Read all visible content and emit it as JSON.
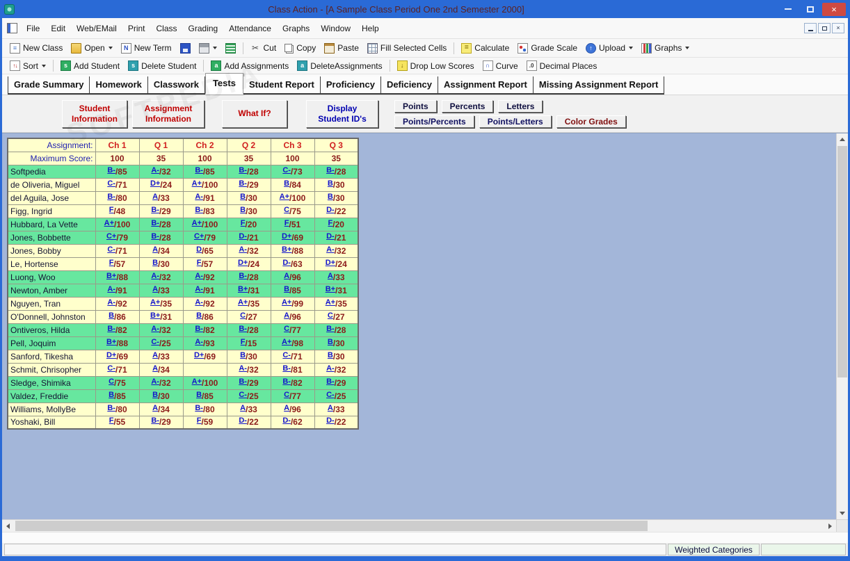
{
  "window": {
    "title": "Class Action - [A Sample Class Period One 2nd Semester 2000]"
  },
  "watermark": "SOFTPEDIA",
  "menu": {
    "items": [
      "File",
      "Edit",
      "Web/EMail",
      "Print",
      "Class",
      "Grading",
      "Attendance",
      "Graphs",
      "Window",
      "Help"
    ]
  },
  "toolbars": {
    "top": [
      {
        "label": "New Class",
        "icon": "new-class"
      },
      {
        "label": "Open",
        "icon": "open-folder",
        "dropdown": true
      },
      {
        "label": "New Term",
        "icon": "new-term"
      },
      {
        "icon": "save"
      },
      {
        "icon": "print",
        "dropdown": true
      },
      {
        "icon": "grade-guide"
      },
      {
        "sep": true
      },
      {
        "label": "Cut",
        "icon": "cut"
      },
      {
        "label": "Copy",
        "icon": "copy"
      },
      {
        "label": "Paste",
        "icon": "paste"
      },
      {
        "label": "Fill Selected Cells",
        "icon": "fill-cells"
      },
      {
        "sep": true
      },
      {
        "label": "Calculate",
        "icon": "calculate"
      },
      {
        "label": "Grade Scale",
        "icon": "grade-scale"
      },
      {
        "label": "Upload",
        "icon": "upload",
        "dropdown": true
      },
      {
        "label": "Graphs",
        "icon": "graphs",
        "dropdown": true
      }
    ],
    "second": [
      {
        "label": "Sort",
        "icon": "sort",
        "dropdown": true
      },
      {
        "sep": true
      },
      {
        "label": "Add Student",
        "icon": "add-student"
      },
      {
        "label": "Delete Student",
        "icon": "delete-student"
      },
      {
        "sep": true
      },
      {
        "label": "Add Assignments",
        "icon": "add-assignments"
      },
      {
        "label": "DeleteAssignments",
        "icon": "delete-assignments"
      },
      {
        "sep": true
      },
      {
        "label": "Drop Low Scores",
        "icon": "drop-low-scores"
      },
      {
        "label": "Curve",
        "icon": "curve"
      },
      {
        "label": "Decimal Places",
        "icon": "decimal-places"
      }
    ]
  },
  "tabs": {
    "items": [
      "Grade Summary",
      "Homework",
      "Classwork",
      "Tests",
      "Student Report",
      "Proficiency",
      "Deficiency",
      "Assignment Report",
      "Missing Assignment Report"
    ],
    "active": "Tests"
  },
  "panel": {
    "big_buttons": [
      {
        "label": "Student Information",
        "color": "#c00000"
      },
      {
        "label": "Assignment Information",
        "color": "#c00000"
      },
      {
        "label": "What If?",
        "color": "#c00000"
      },
      {
        "label": "Display Student ID's",
        "color": "#0000b0"
      }
    ],
    "view_buttons": [
      [
        {
          "label": "Points",
          "color": "#101040"
        },
        {
          "label": "Percents",
          "color": "#101040"
        },
        {
          "label": "Letters",
          "color": "#101040"
        }
      ],
      [
        {
          "label": "Points/Percents",
          "color": "#101060"
        },
        {
          "label": "Points/Letters",
          "color": "#101060"
        },
        {
          "label": "Color Grades",
          "color": "#801010"
        }
      ]
    ]
  },
  "table": {
    "corner_label": "Assignment:",
    "max_label": "Maximum Score:",
    "columns": [
      "Ch 1",
      "Q 1",
      "Ch 2",
      "Q 2",
      "Ch 3",
      "Q 3"
    ],
    "max_scores": [
      "100",
      "35",
      "100",
      "35",
      "100",
      "35"
    ],
    "rows": [
      {
        "name": "Softpedia",
        "color": "green",
        "grades": [
          [
            "B-",
            "85"
          ],
          [
            "A-",
            "32"
          ],
          [
            "B-",
            "85"
          ],
          [
            "B-",
            "28"
          ],
          [
            "C-",
            "73"
          ],
          [
            "B-",
            "28"
          ]
        ]
      },
      {
        "name": "de Oliveria, Miguel",
        "color": "yellow",
        "grades": [
          [
            "C-",
            "71"
          ],
          [
            "D+",
            "24"
          ],
          [
            "A+",
            "100"
          ],
          [
            "B-",
            "29"
          ],
          [
            "B",
            "84"
          ],
          [
            "B",
            "30"
          ]
        ]
      },
      {
        "name": "del Aguila, Jose",
        "color": "yellow",
        "grades": [
          [
            "B-",
            "80"
          ],
          [
            "A",
            "33"
          ],
          [
            "A-",
            "91"
          ],
          [
            "B",
            "30"
          ],
          [
            "A+",
            "100"
          ],
          [
            "B",
            "30"
          ]
        ]
      },
      {
        "name": "Figg, Ingrid",
        "color": "yellow",
        "grades": [
          [
            "F",
            "48"
          ],
          [
            "B-",
            "29"
          ],
          [
            "B-",
            "83"
          ],
          [
            "B",
            "30"
          ],
          [
            "C",
            "75"
          ],
          [
            "D-",
            "22"
          ]
        ]
      },
      {
        "name": "Hubbard, La Vette",
        "color": "green",
        "grades": [
          [
            "A+",
            "100"
          ],
          [
            "B-",
            "28"
          ],
          [
            "A+",
            "100"
          ],
          [
            "F",
            "20"
          ],
          [
            "F",
            "51"
          ],
          [
            "F",
            "20"
          ]
        ]
      },
      {
        "name": "Jones, Bobbette",
        "color": "green",
        "grades": [
          [
            "C+",
            "79"
          ],
          [
            "B-",
            "28"
          ],
          [
            "C+",
            "79"
          ],
          [
            "D-",
            "21"
          ],
          [
            "D+",
            "69"
          ],
          [
            "D-",
            "21"
          ]
        ]
      },
      {
        "name": "Jones, Bobby",
        "color": "yellow",
        "grades": [
          [
            "C-",
            "71"
          ],
          [
            "A",
            "34"
          ],
          [
            "D",
            "65"
          ],
          [
            "A-",
            "32"
          ],
          [
            "B+",
            "88"
          ],
          [
            "A-",
            "32"
          ]
        ]
      },
      {
        "name": "Le, Hortense",
        "color": "yellow",
        "grades": [
          [
            "F",
            "57"
          ],
          [
            "B",
            "30"
          ],
          [
            "F",
            "57"
          ],
          [
            "D+",
            "24"
          ],
          [
            "D-",
            "63"
          ],
          [
            "D+",
            "24"
          ]
        ]
      },
      {
        "name": "Luong, Woo",
        "color": "green",
        "grades": [
          [
            "B+",
            "88"
          ],
          [
            "A-",
            "32"
          ],
          [
            "A-",
            "92"
          ],
          [
            "B-",
            "28"
          ],
          [
            "A",
            "96"
          ],
          [
            "A",
            "33"
          ]
        ]
      },
      {
        "name": "Newton, Amber",
        "color": "green",
        "grades": [
          [
            "A-",
            "91"
          ],
          [
            "A",
            "33"
          ],
          [
            "A-",
            "91"
          ],
          [
            "B+",
            "31"
          ],
          [
            "B",
            "85"
          ],
          [
            "B+",
            "31"
          ]
        ]
      },
      {
        "name": "Nguyen, Tran",
        "color": "yellow",
        "grades": [
          [
            "A-",
            "92"
          ],
          [
            "A+",
            "35"
          ],
          [
            "A-",
            "92"
          ],
          [
            "A+",
            "35"
          ],
          [
            "A+",
            "99"
          ],
          [
            "A+",
            "35"
          ]
        ]
      },
      {
        "name": "O'Donnell, Johnston",
        "color": "yellow",
        "grades": [
          [
            "B",
            "86"
          ],
          [
            "B+",
            "31"
          ],
          [
            "B",
            "86"
          ],
          [
            "C",
            "27"
          ],
          [
            "A",
            "96"
          ],
          [
            "C",
            "27"
          ]
        ]
      },
      {
        "name": "Ontiveros, Hilda",
        "color": "green",
        "grades": [
          [
            "B-",
            "82"
          ],
          [
            "A-",
            "32"
          ],
          [
            "B-",
            "82"
          ],
          [
            "B-",
            "28"
          ],
          [
            "C",
            "77"
          ],
          [
            "B-",
            "28"
          ]
        ]
      },
      {
        "name": "Pell, Joquim",
        "color": "green",
        "grades": [
          [
            "B+",
            "88"
          ],
          [
            "C-",
            "25"
          ],
          [
            "A-",
            "93"
          ],
          [
            "F",
            "15"
          ],
          [
            "A+",
            "98"
          ],
          [
            "B",
            "30"
          ]
        ]
      },
      {
        "name": "Sanford, Tikesha",
        "color": "yellow",
        "grades": [
          [
            "D+",
            "69"
          ],
          [
            "A",
            "33"
          ],
          [
            "D+",
            "69"
          ],
          [
            "B",
            "30"
          ],
          [
            "C-",
            "71"
          ],
          [
            "B",
            "30"
          ]
        ]
      },
      {
        "name": "Schmit, Chrisopher",
        "color": "yellow",
        "grades": [
          [
            "C-",
            "71"
          ],
          [
            "A",
            "34"
          ],
          null,
          [
            "A-",
            "32"
          ],
          [
            "B-",
            "81"
          ],
          [
            "A-",
            "32"
          ]
        ]
      },
      {
        "name": "Sledge, Shimika",
        "color": "green",
        "grades": [
          [
            "C",
            "75"
          ],
          [
            "A-",
            "32"
          ],
          [
            "A+",
            "100"
          ],
          [
            "B-",
            "29"
          ],
          [
            "B-",
            "82"
          ],
          [
            "B-",
            "29"
          ]
        ]
      },
      {
        "name": "Valdez, Freddie",
        "color": "green",
        "grades": [
          [
            "B",
            "85"
          ],
          [
            "B",
            "30"
          ],
          [
            "B",
            "85"
          ],
          [
            "C-",
            "25"
          ],
          [
            "C",
            "77"
          ],
          [
            "C-",
            "25"
          ]
        ]
      },
      {
        "name": "Williams, MollyBe",
        "color": "yellow",
        "grades": [
          [
            "B-",
            "80"
          ],
          [
            "A",
            "34"
          ],
          [
            "B-",
            "80"
          ],
          [
            "A",
            "33"
          ],
          [
            "A",
            "96"
          ],
          [
            "A",
            "33"
          ]
        ]
      },
      {
        "name": "Yoshaki, Bill",
        "color": "yellow",
        "grades": [
          [
            "F",
            "55"
          ],
          [
            "B-",
            "29"
          ],
          [
            "F",
            "59"
          ],
          [
            "D-",
            "22"
          ],
          [
            "D-",
            "62"
          ],
          [
            "D-",
            "22"
          ]
        ]
      }
    ]
  },
  "statusbar": {
    "weighted_label": "Weighted Categories"
  },
  "colors": {
    "titlebar": "#2a6ad6",
    "title_text": "#5c2222",
    "content_bg": "#a3b6d9",
    "row_green": "#67e79f",
    "row_yellow": "#ffffcc",
    "grade_letter_blue": "#1414cc",
    "grade_score_maroon": "#8b1a1a",
    "header_red": "#d02020",
    "label_navy": "#2020b0"
  }
}
